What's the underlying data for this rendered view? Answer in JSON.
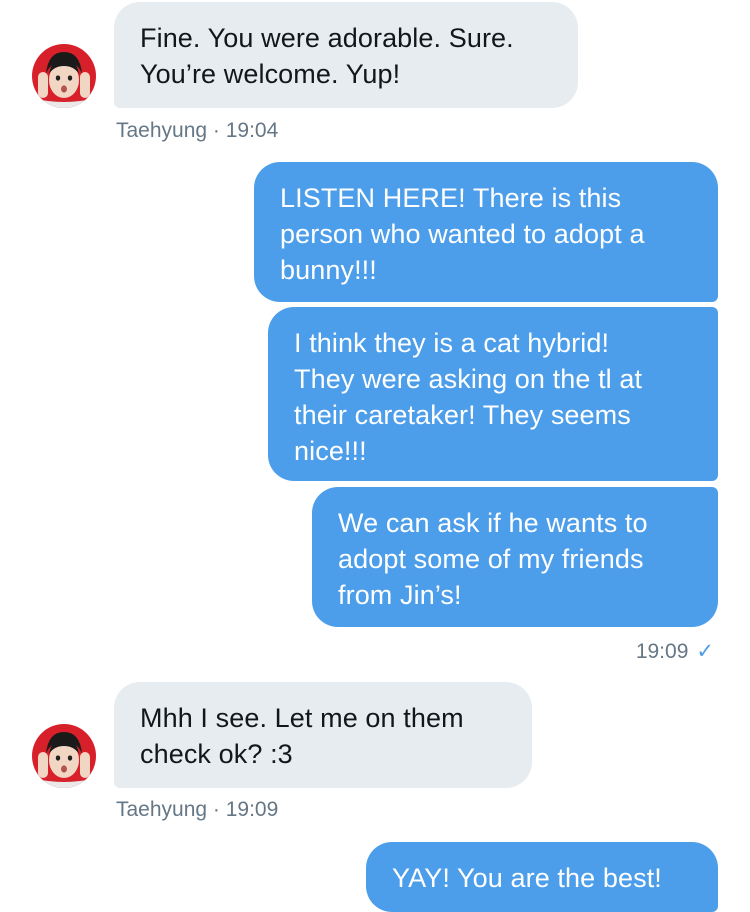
{
  "conversation": {
    "messages": [
      {
        "sender": "Taehyung",
        "direction": "received",
        "text": "Fine. You were adorable. Sure.\nYou’re welcome. Yup!"
      },
      {
        "direction": "sent",
        "text": "LISTEN HERE! There is this\nperson who wanted to adopt a\nbunny!!!"
      },
      {
        "direction": "sent",
        "text": "I think they is a cat hybrid!\nThey were asking on the tl at\ntheir caretaker! They seems\nnice!!!"
      },
      {
        "direction": "sent",
        "text": "We can ask if he wants to\nadopt some of my friends\nfrom Jin’s!"
      },
      {
        "sender": "Taehyung",
        "direction": "received",
        "text": "Mhh I see. Let me on them\ncheck ok? :3"
      },
      {
        "direction": "sent",
        "text": "YAY! You are the best!"
      }
    ],
    "meta": {
      "first_received": "Taehyung · 19:04",
      "sent_group_time": "19:09",
      "second_received": "Taehyung · 19:09",
      "read_icon": "checkmark-icon"
    }
  },
  "colors": {
    "sent_bubble": "#4d9eea",
    "received_bubble": "#e6ecf0",
    "meta_text": "#657786",
    "avatar_background": "#d8202a"
  }
}
